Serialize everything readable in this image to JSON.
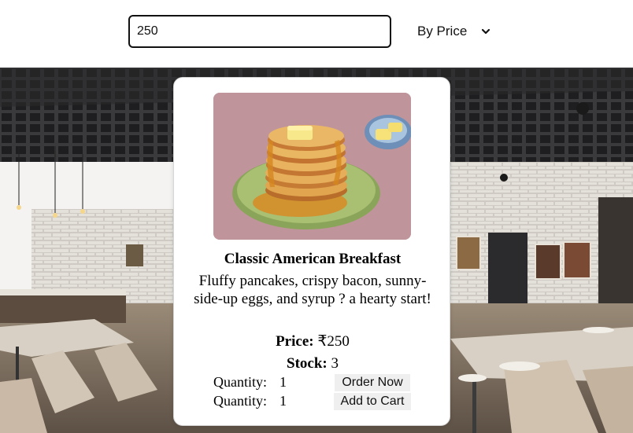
{
  "search": {
    "value": "250",
    "placeholder": ""
  },
  "sort": {
    "selected": "By Price",
    "icon": "chevron-down-icon"
  },
  "product": {
    "image_alt": "pancake-stack",
    "title": "Classic American Breakfast",
    "description": "Fluffy pancakes, crispy bacon, sunny-side-up eggs, and syrup ? a hearty start!",
    "price_label": "Price:",
    "price_value": "₹250",
    "stock_label": "Stock:",
    "stock_value": "3",
    "order_row": {
      "quantity_label": "Quantity:",
      "quantity_value": "1",
      "button_label": "Order Now"
    },
    "cart_row": {
      "quantity_label": "Quantity:",
      "quantity_value": "1",
      "button_label": "Add to Cart"
    }
  },
  "colors": {
    "ceiling": "#2e2e30",
    "brick_wall": "#d9d7d2",
    "floor": "#8a7c6c",
    "table_top": "#d8d0c4",
    "plate": "#a9bf72",
    "pancake": "#d99a45",
    "photo_bg": "#b98f96"
  }
}
